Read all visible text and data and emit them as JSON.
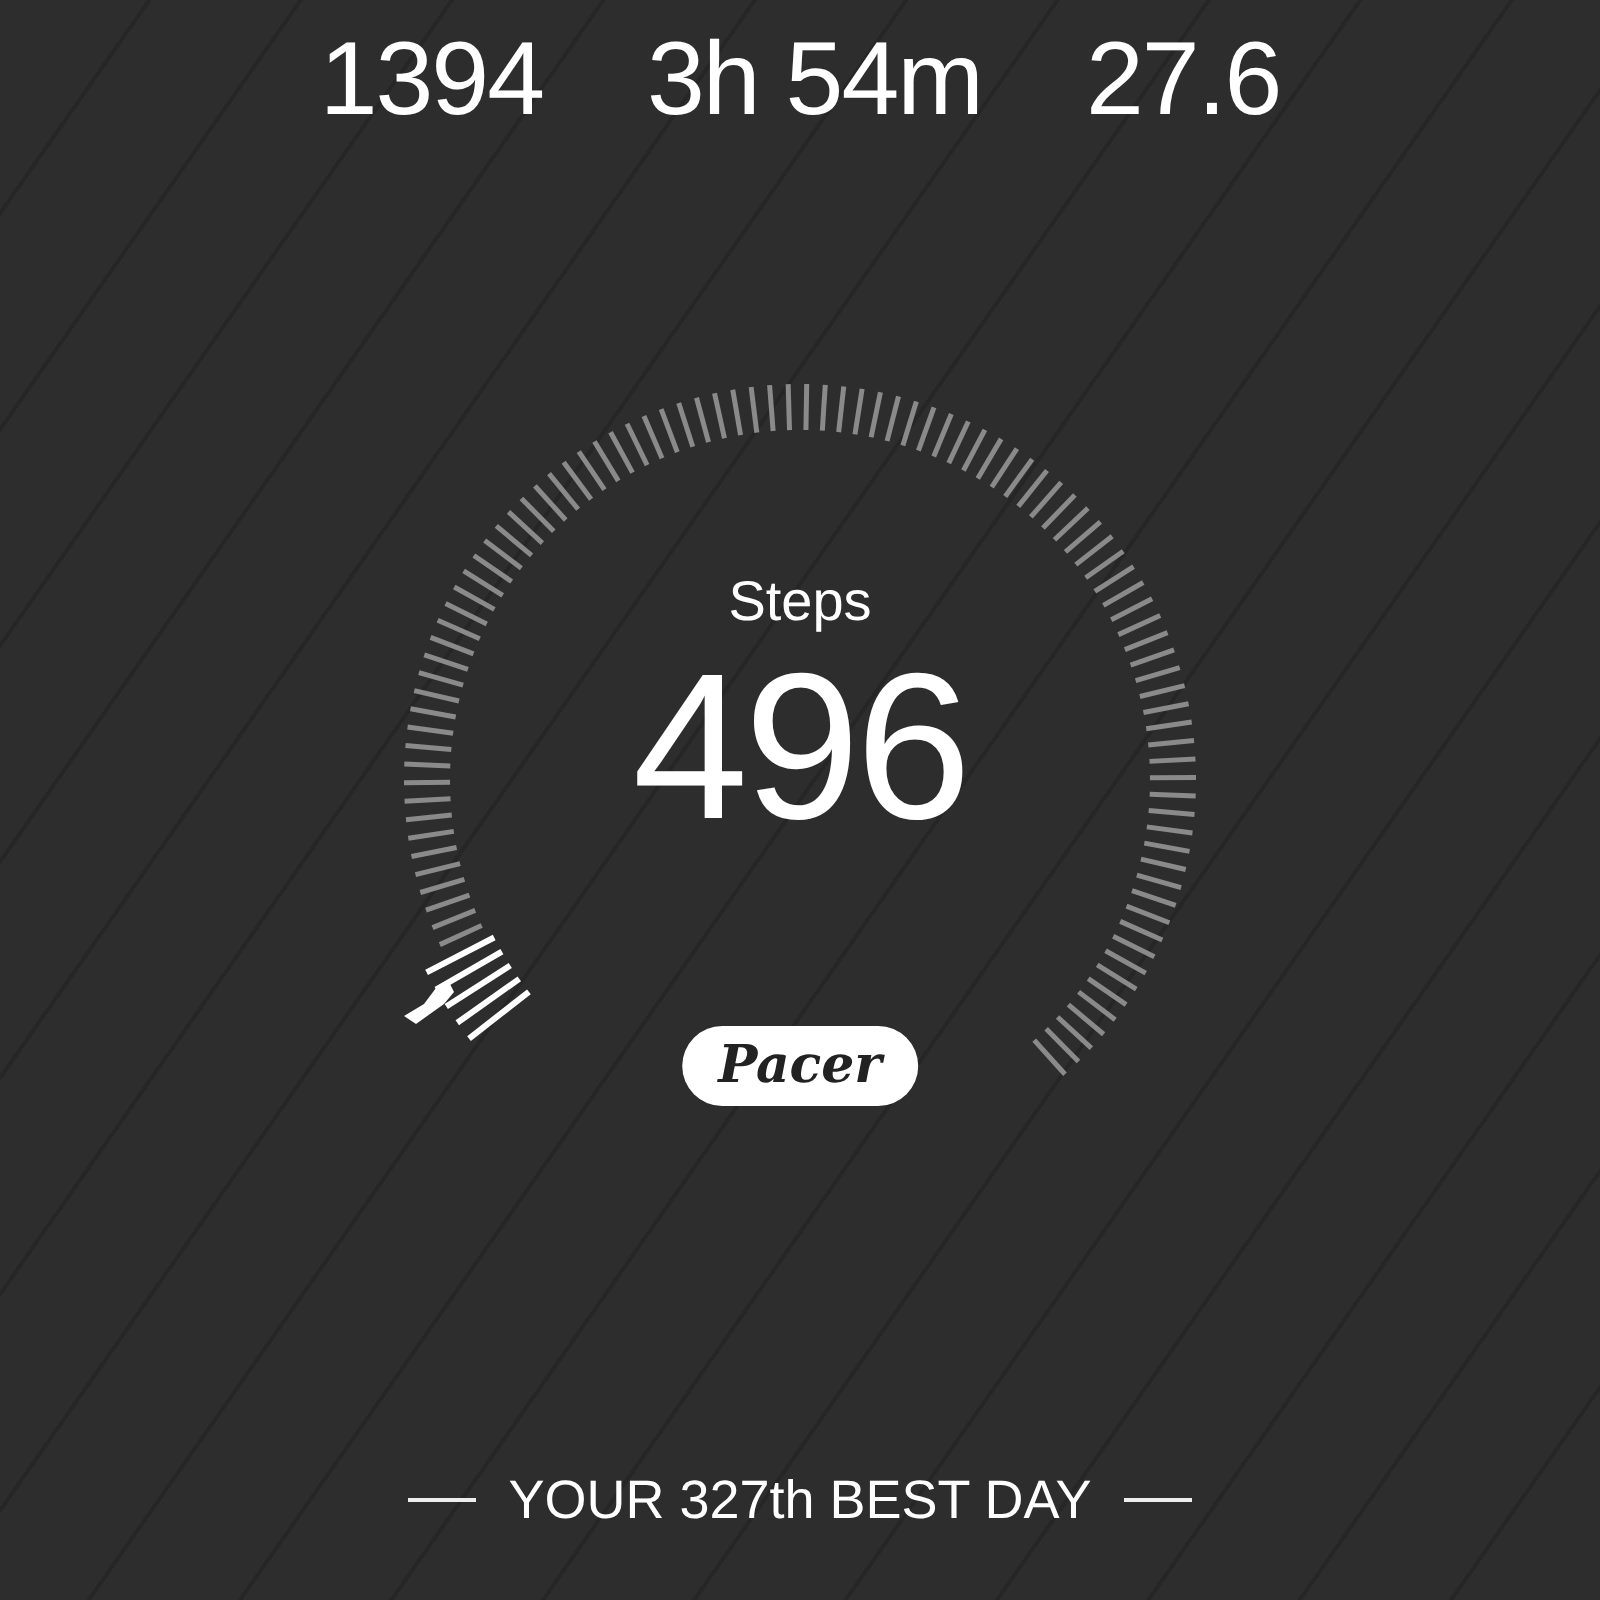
{
  "stats": [
    {
      "value": "1394"
    },
    {
      "value": "3h 54m"
    },
    {
      "value": "27.6"
    }
  ],
  "gauge": {
    "label": "Steps",
    "value": "496"
  },
  "logo": "Pacer",
  "rank": "YOUR 327th BEST DAY"
}
